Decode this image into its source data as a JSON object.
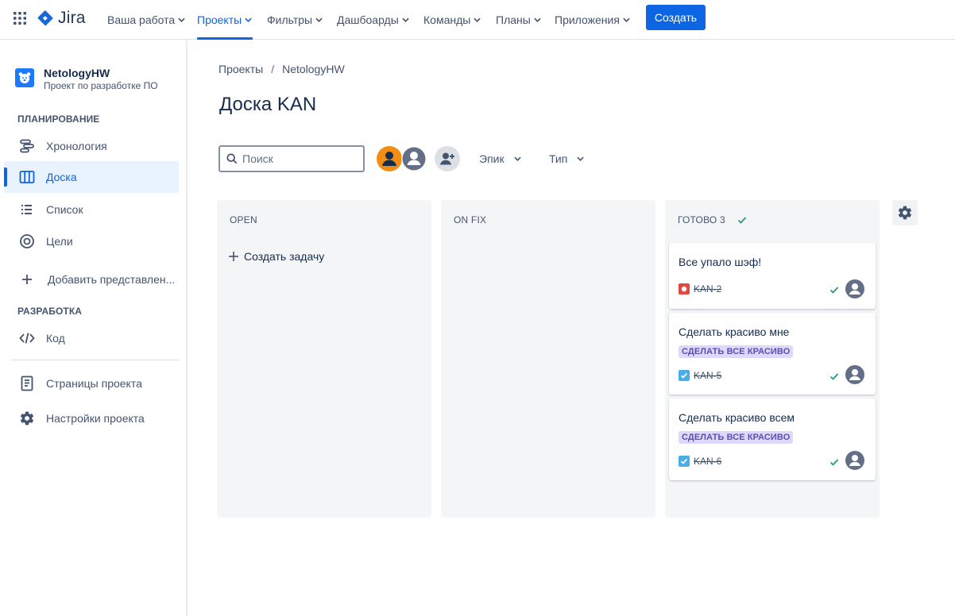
{
  "topnav": {
    "logo_text": "Jira",
    "items": [
      {
        "label": "Ваша работа"
      },
      {
        "label": "Проекты"
      },
      {
        "label": "Фильтры"
      },
      {
        "label": "Дашбоарды"
      },
      {
        "label": "Команды"
      },
      {
        "label": "Планы"
      },
      {
        "label": "Приложения"
      }
    ],
    "active_item": "Проекты",
    "create_label": "Создать"
  },
  "sidebar": {
    "project_name": "NetologyHW",
    "project_subtitle": "Проект по разработке ПО",
    "planning_title": "ПЛАНИРОВАНИЕ",
    "planning_items": [
      {
        "label": "Хронология",
        "icon": "timeline-icon"
      },
      {
        "label": "Доска",
        "icon": "board-icon"
      },
      {
        "label": "Список",
        "icon": "list-icon"
      },
      {
        "label": "Цели",
        "icon": "goals-icon"
      }
    ],
    "add_view_label": "Добавить представлен...",
    "dev_title": "РАЗРАБОТКА",
    "dev_items": [
      {
        "label": "Код",
        "icon": "code-icon"
      }
    ],
    "bottom_items": [
      {
        "label": "Страницы проекта",
        "icon": "page-icon"
      },
      {
        "label": "Настройки проекта",
        "icon": "gear-icon"
      }
    ],
    "active_item": "Доска"
  },
  "breadcrumb": {
    "items": [
      "Проекты",
      "NetologyHW"
    ],
    "separator": "/"
  },
  "page_title": "Доска KAN",
  "toolbar": {
    "search_placeholder": "Поиск",
    "search_value": "",
    "epic_label": "Эпик",
    "type_label": "Тип"
  },
  "board": {
    "columns": [
      {
        "name": "OPEN",
        "create_label": "Создать задачу"
      },
      {
        "name": "ON FIX"
      },
      {
        "name": "ГОТОВО 3",
        "done": true
      }
    ],
    "cards": [
      {
        "title": "Все упало шэф!",
        "key": "KAN-2",
        "issue_type": "bug-icon",
        "epic": ""
      },
      {
        "title": "Сделать красиво мне",
        "key": "KAN-5",
        "issue_type": "task-icon",
        "epic": "СДЕЛАТЬ ВСЕ КРАСИВО"
      },
      {
        "title": "Сделать красиво всем",
        "key": "KAN-6",
        "issue_type": "task-icon",
        "epic": "СДЕЛАТЬ ВСЕ КРАСИВО"
      }
    ]
  },
  "colors": {
    "brand": "#0c66e4",
    "done_check": "#22a06b",
    "epic_bg": "#dfd8fd",
    "epic_text": "#5e4db2",
    "bug": "#e2483d",
    "task": "#4bade8",
    "avatar_orange": "#f18d13"
  }
}
